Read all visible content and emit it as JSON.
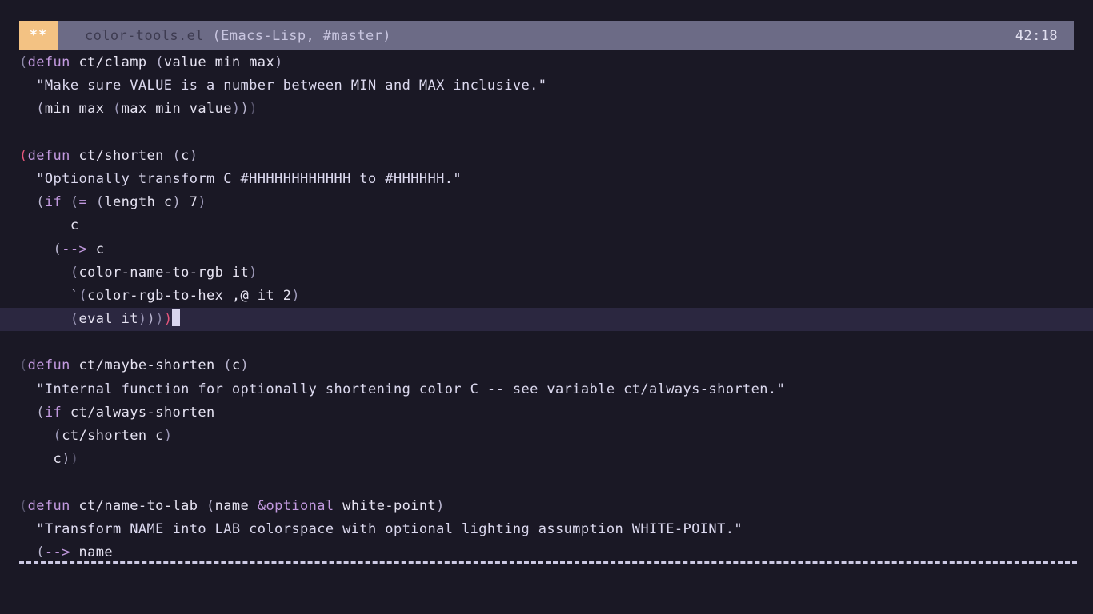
{
  "app": {
    "name": "emacs",
    "background": "#1a1825"
  },
  "modeline": {
    "modified_indicator": "**",
    "buffer_name": "color-tools.el",
    "mode_open": " (",
    "major_mode": "Emacs-Lisp",
    "separator": ", ",
    "branch": "#master",
    "mode_close": ")",
    "clock": "42:18",
    "badge_color": "#f3c283",
    "bar_color": "#6c6b86",
    "buffer_name_color": "#3d3b50",
    "branch_color": "#c9c6e0"
  },
  "buffer": {
    "language": "Emacs-Lisp",
    "current_line_index": 11,
    "current_line_bg": "#2b2740",
    "cursor_color": "#d9d6ee",
    "lines": [
      {
        "text": "(defun ct/clamp (value min max)"
      },
      {
        "text": "  \"Make sure VALUE is a number between MIN and MAX inclusive.\""
      },
      {
        "text": "  (min max (max min value)))"
      },
      {
        "text": ""
      },
      {
        "text": "(defun ct/shorten (c)"
      },
      {
        "text": "  \"Optionally transform C #HHHHHHHHHHHH to #HHHHHH.\""
      },
      {
        "text": "  (if (= (length c) 7)"
      },
      {
        "text": "      c"
      },
      {
        "text": "    (--> c"
      },
      {
        "text": "      (color-name-to-rgb it)"
      },
      {
        "text": "      `(color-rgb-to-hex ,@ it 2)"
      },
      {
        "text": "      (eval it))))"
      },
      {
        "text": ""
      },
      {
        "text": "(defun ct/maybe-shorten (c)"
      },
      {
        "text": "  \"Internal function for optionally shortening color C -- see variable ct/always-shorten.\""
      },
      {
        "text": "  (if ct/always-shorten"
      },
      {
        "text": "    (ct/shorten c)"
      },
      {
        "text": "    c))"
      },
      {
        "text": ""
      },
      {
        "text": "(defun ct/name-to-lab (name &optional white-point)"
      },
      {
        "text": "  \"Transform NAME into LAB colorspace with optional lighting assumption WHITE-POINT.\""
      },
      {
        "text": "  (--> name"
      }
    ]
  },
  "footer": {
    "rule_style": "dashed",
    "rule_color": "#cbc8e2"
  }
}
